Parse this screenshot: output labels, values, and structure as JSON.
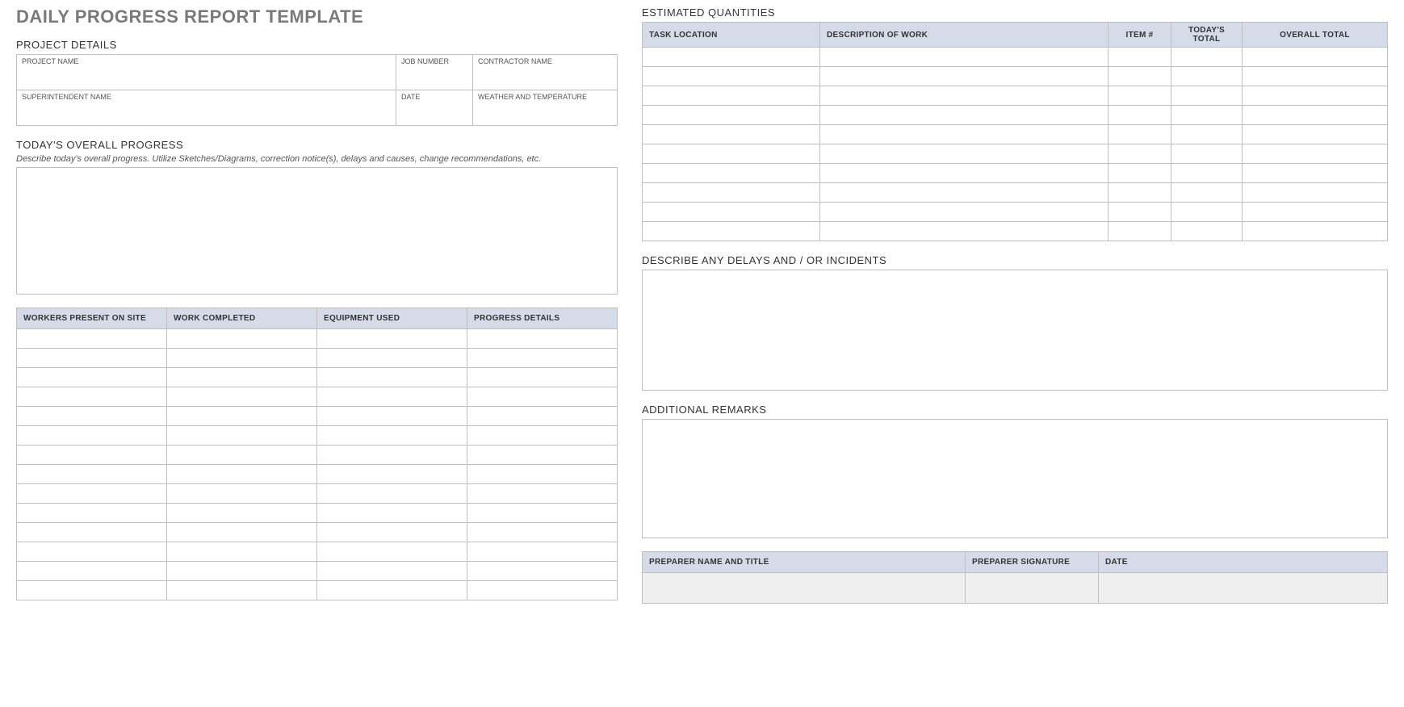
{
  "title": "DAILY PROGRESS REPORT TEMPLATE",
  "projectDetails": {
    "heading": "PROJECT DETAILS",
    "labels": {
      "projectName": "PROJECT NAME",
      "jobNumber": "JOB NUMBER",
      "contractorName": "CONTRACTOR NAME",
      "superintendentName": "SUPERINTENDENT NAME",
      "date": "DATE",
      "weather": "WEATHER AND TEMPERATURE"
    },
    "values": {
      "projectName": "",
      "jobNumber": "",
      "contractorName": "",
      "superintendentName": "",
      "date": "",
      "weather": ""
    }
  },
  "overallProgress": {
    "heading": "TODAY'S OVERALL PROGRESS",
    "hint": "Describe today's overall progress.  Utilize Sketches/Diagrams, correction notice(s), delays and causes, change recommendations, etc.",
    "value": ""
  },
  "progressTable": {
    "headers": {
      "workers": "WORKERS PRESENT ON SITE",
      "completed": "WORK COMPLETED",
      "equipment": "EQUIPMENT USED",
      "details": "PROGRESS DETAILS"
    },
    "rows": [
      {
        "workers": "",
        "completed": "",
        "equipment": "",
        "details": ""
      },
      {
        "workers": "",
        "completed": "",
        "equipment": "",
        "details": ""
      },
      {
        "workers": "",
        "completed": "",
        "equipment": "",
        "details": ""
      },
      {
        "workers": "",
        "completed": "",
        "equipment": "",
        "details": ""
      },
      {
        "workers": "",
        "completed": "",
        "equipment": "",
        "details": ""
      },
      {
        "workers": "",
        "completed": "",
        "equipment": "",
        "details": ""
      },
      {
        "workers": "",
        "completed": "",
        "equipment": "",
        "details": ""
      },
      {
        "workers": "",
        "completed": "",
        "equipment": "",
        "details": ""
      },
      {
        "workers": "",
        "completed": "",
        "equipment": "",
        "details": ""
      },
      {
        "workers": "",
        "completed": "",
        "equipment": "",
        "details": ""
      },
      {
        "workers": "",
        "completed": "",
        "equipment": "",
        "details": ""
      },
      {
        "workers": "",
        "completed": "",
        "equipment": "",
        "details": ""
      },
      {
        "workers": "",
        "completed": "",
        "equipment": "",
        "details": ""
      },
      {
        "workers": "",
        "completed": "",
        "equipment": "",
        "details": ""
      }
    ]
  },
  "estimatedQuantities": {
    "heading": "ESTIMATED QUANTITIES",
    "headers": {
      "taskLocation": "TASK LOCATION",
      "description": "DESCRIPTION OF WORK",
      "item": "ITEM #",
      "todaysTotal": "TODAY'S TOTAL",
      "overallTotal": "OVERALL TOTAL"
    },
    "rows": [
      {
        "taskLocation": "",
        "description": "",
        "item": "",
        "todaysTotal": "",
        "overallTotal": ""
      },
      {
        "taskLocation": "",
        "description": "",
        "item": "",
        "todaysTotal": "",
        "overallTotal": ""
      },
      {
        "taskLocation": "",
        "description": "",
        "item": "",
        "todaysTotal": "",
        "overallTotal": ""
      },
      {
        "taskLocation": "",
        "description": "",
        "item": "",
        "todaysTotal": "",
        "overallTotal": ""
      },
      {
        "taskLocation": "",
        "description": "",
        "item": "",
        "todaysTotal": "",
        "overallTotal": ""
      },
      {
        "taskLocation": "",
        "description": "",
        "item": "",
        "todaysTotal": "",
        "overallTotal": ""
      },
      {
        "taskLocation": "",
        "description": "",
        "item": "",
        "todaysTotal": "",
        "overallTotal": ""
      },
      {
        "taskLocation": "",
        "description": "",
        "item": "",
        "todaysTotal": "",
        "overallTotal": ""
      },
      {
        "taskLocation": "",
        "description": "",
        "item": "",
        "todaysTotal": "",
        "overallTotal": ""
      },
      {
        "taskLocation": "",
        "description": "",
        "item": "",
        "todaysTotal": "",
        "overallTotal": ""
      }
    ]
  },
  "delays": {
    "heading": "DESCRIBE ANY DELAYS AND / OR INCIDENTS",
    "value": ""
  },
  "remarks": {
    "heading": "ADDITIONAL REMARKS",
    "value": ""
  },
  "preparer": {
    "headers": {
      "nameTitle": "PREPARER NAME AND TITLE",
      "signature": "PREPARER SIGNATURE",
      "date": "DATE"
    },
    "values": {
      "nameTitle": "",
      "signature": "",
      "date": ""
    }
  }
}
